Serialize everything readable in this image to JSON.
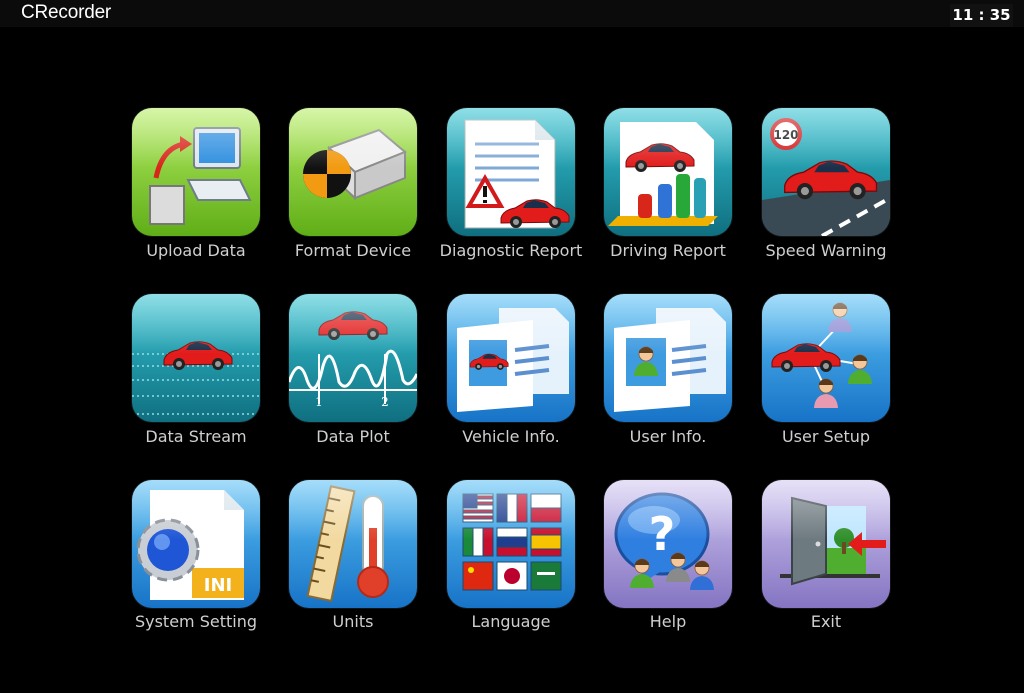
{
  "window": {
    "title": "CRecorder",
    "clock": "11 : 35"
  },
  "menu": {
    "items": [
      {
        "label": "Upload Data"
      },
      {
        "label": "Format Device"
      },
      {
        "label": "Diagnostic Report"
      },
      {
        "label": "Driving Report"
      },
      {
        "label": "Speed Warning"
      },
      {
        "label": "Data Stream"
      },
      {
        "label": "Data Plot"
      },
      {
        "label": "Vehicle Info."
      },
      {
        "label": "User Info."
      },
      {
        "label": "User Setup"
      },
      {
        "label": "System Setting"
      },
      {
        "label": "Units"
      },
      {
        "label": "Language"
      },
      {
        "label": "Help"
      },
      {
        "label": "Exit"
      }
    ],
    "icon_text": {
      "speed_limit": "120",
      "plot_tick_1": "1",
      "plot_tick_2": "2",
      "ini": "INI"
    }
  },
  "colors": {
    "green": "#8ed43a",
    "teal": "#1fa3b5",
    "blue": "#2e9be0",
    "purple": "#a08ed0",
    "car_red": "#e21b1b"
  }
}
